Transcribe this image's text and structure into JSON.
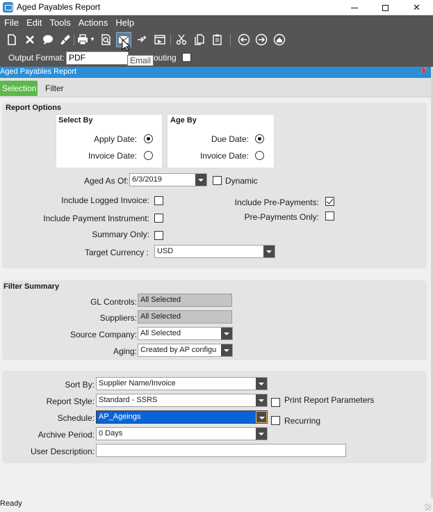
{
  "window": {
    "title": "Aged Payables Report"
  },
  "menu": {
    "items": [
      "File",
      "Edit",
      "Tools",
      "Actions",
      "Help"
    ]
  },
  "toolbar": {
    "icons": [
      "new-icon",
      "delete-icon",
      "comment-icon",
      "clear-icon",
      "print-icon",
      "preview-icon",
      "email-icon",
      "generate-icon",
      "schedule-icon",
      "cut-icon",
      "copy-icon",
      "paste-icon",
      "back-icon",
      "forward-icon",
      "home-icon"
    ],
    "tooltip": "Email"
  },
  "options": {
    "output_format_label": "Output Format:",
    "output_format_value": "PDF",
    "routing_label": "outing"
  },
  "panel": {
    "title": "Aged Payables Report"
  },
  "tabs": {
    "selection": "Selection",
    "filter": "Filter"
  },
  "report_options": {
    "title": "Report Options",
    "select_by": {
      "title": "Select By",
      "apply_date": "Apply Date:",
      "invoice_date": "Invoice Date:"
    },
    "age_by": {
      "title": "Age By",
      "due_date": "Due Date:",
      "invoice_date": "Invoice Date:"
    },
    "aged_as_of_label": "Aged As Of:",
    "aged_as_of_value": "6/3/2019",
    "dynamic_label": "Dynamic",
    "include_logged_invoice": "Include Logged Invoice:",
    "include_payment_instrument": "Include Payment Instrument:",
    "summary_only": "Summary Only:",
    "include_pre_payments": "Include Pre-Payments:",
    "pre_payments_only": "Pre-Payments Only:",
    "target_currency_label": "Target Currency :",
    "target_currency_value": "USD"
  },
  "filter_summary": {
    "title": "Filter Summary",
    "gl_controls_label": "GL Controls:",
    "gl_controls_value": "All Selected",
    "suppliers_label": "Suppliers:",
    "suppliers_value": "All Selected",
    "source_company_label": "Source Company:",
    "source_company_value": "All Selected",
    "aging_label": "Aging:",
    "aging_value": "Created by AP configu"
  },
  "bottom": {
    "sort_by_label": "Sort By:",
    "sort_by_value": "Supplier Name/Invoice",
    "report_style_label": "Report Style:",
    "report_style_value": "Standard - SSRS",
    "print_params_label": "Print Report Parameters",
    "schedule_label": "Schedule:",
    "schedule_value": "AP_Ageings",
    "recurring_label": "Recurring",
    "archive_label": "Archive Period:",
    "archive_value": "0 Days",
    "user_desc_label": "User Description:",
    "user_desc_value": ""
  },
  "status": {
    "text": "Ready"
  },
  "colors": {
    "accent_green": "#5bb948",
    "header_blue": "#2b8fd6",
    "toolbar_gray": "#555555"
  }
}
